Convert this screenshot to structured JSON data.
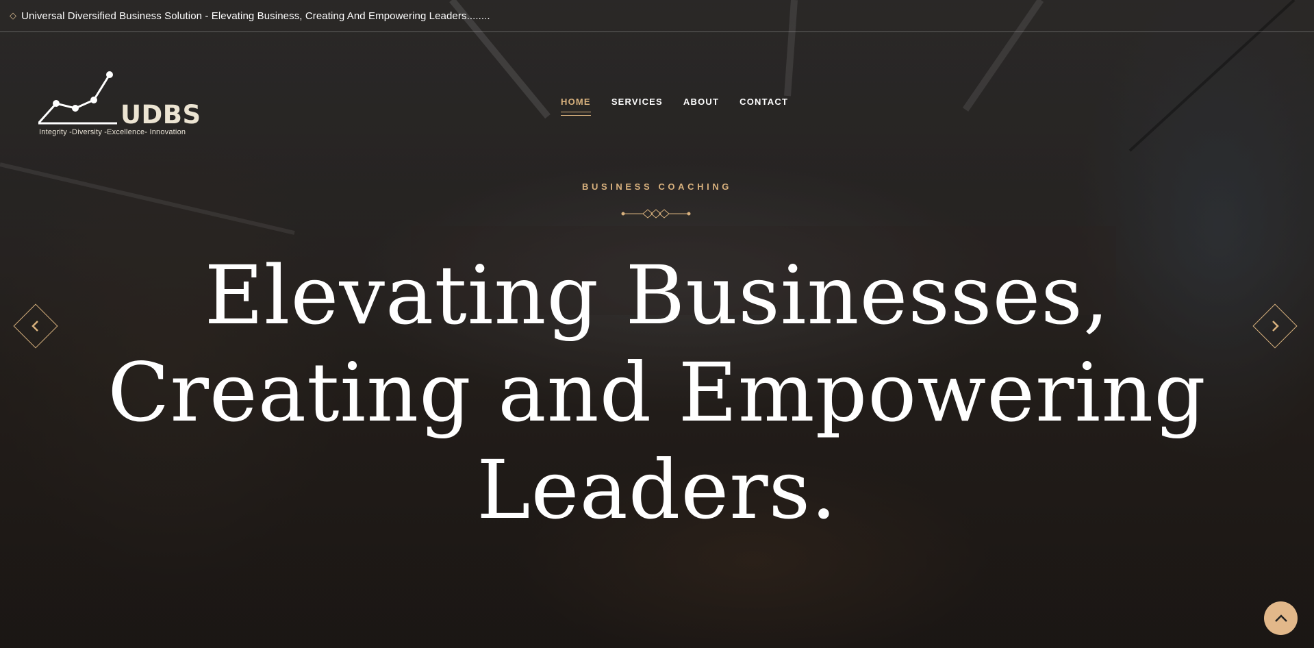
{
  "topbar": {
    "icon": "diamond-icon",
    "text": "Universal Diversified Business Solution - Elevating Business, Creating And Empowering Leaders........"
  },
  "logo": {
    "name": "UDBS",
    "tagline": "Integrity -Diversity -Excellence- Innovation"
  },
  "nav": {
    "items": [
      {
        "label": "HOME",
        "active": true
      },
      {
        "label": "SERVICES",
        "active": false
      },
      {
        "label": "ABOUT",
        "active": false
      },
      {
        "label": "CONTACT",
        "active": false
      }
    ]
  },
  "hero": {
    "subtitle": "BUSINESS COACHING",
    "headline_lines": [
      "Elevating Businesses,",
      "Creating and Empowering",
      "Leaders."
    ]
  },
  "controls": {
    "prev_icon": "chevron-left-icon",
    "next_icon": "chevron-right-icon",
    "to_top_icon": "chevron-up-icon"
  },
  "colors": {
    "accent": "#d9b27e",
    "to_top_bg": "#e2b88a",
    "logo_text": "#ece4d2"
  }
}
